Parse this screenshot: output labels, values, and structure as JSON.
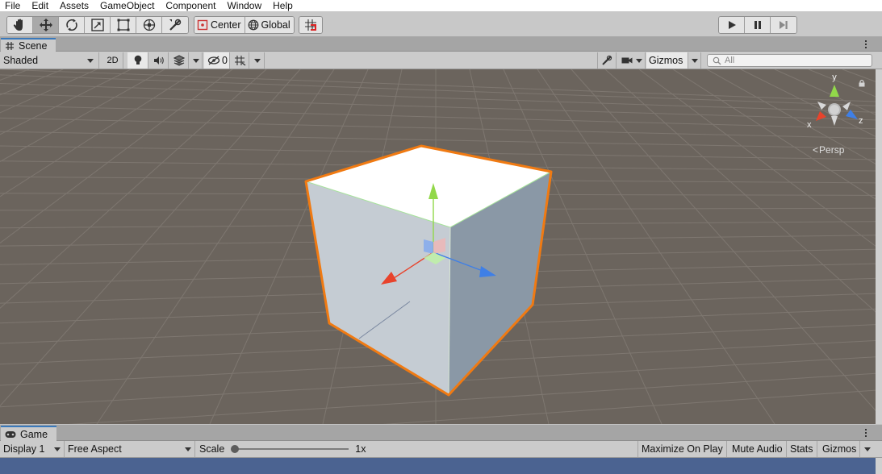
{
  "menu": [
    "File",
    "Edit",
    "Assets",
    "GameObject",
    "Component",
    "Window",
    "Help"
  ],
  "toolbar": {
    "tools": [
      "hand-tool-icon",
      "move-tool-icon",
      "rotate-tool-icon",
      "scale-tool-icon",
      "rect-tool-icon",
      "transform-tool-icon",
      "custom-tool-icon"
    ],
    "pivot_label": "Center",
    "space_label": "Global"
  },
  "scene_tab": {
    "label": "Scene"
  },
  "scene_toolbar": {
    "draw_mode": "Shaded",
    "mode_2d": "2D",
    "hidden_count": "0",
    "gizmos_label": "Gizmos",
    "search_placeholder": "All"
  },
  "orientation_gizmo": {
    "x_label": "x",
    "y_label": "y",
    "z_label": "z",
    "projection_label": "Persp"
  },
  "game_tab": {
    "label": "Game"
  },
  "game_toolbar": {
    "display": "Display 1",
    "aspect": "Free Aspect",
    "scale_label": "Scale",
    "scale_value": "1x",
    "maximize_label": "Maximize On Play",
    "mute_label": "Mute Audio",
    "stats_label": "Stats",
    "gizmos_label": "Gizmos"
  },
  "colors": {
    "selection_outline": "#f07a12",
    "axis_x": "#e8432c",
    "axis_y": "#92d84a",
    "axis_z": "#3f7fe6",
    "tab_accent": "#3a79bb"
  }
}
